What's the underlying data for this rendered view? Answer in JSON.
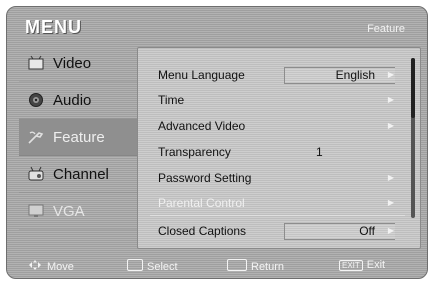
{
  "header": {
    "title": "MENU",
    "section": "Feature"
  },
  "sidebar": {
    "items": [
      {
        "label": "Video",
        "icon": "video-icon"
      },
      {
        "label": "Audio",
        "icon": "audio-icon"
      },
      {
        "label": "Feature",
        "icon": "feature-icon"
      },
      {
        "label": "Channel",
        "icon": "channel-icon"
      },
      {
        "label": "VGA",
        "icon": "vga-icon"
      }
    ]
  },
  "panel": {
    "rows": [
      {
        "label": "Menu Language",
        "value": "English"
      },
      {
        "label": "Time"
      },
      {
        "label": "Advanced Video"
      },
      {
        "label": "Transparency",
        "value": "1"
      },
      {
        "label": "Password Setting"
      },
      {
        "label": "Parental Control"
      },
      {
        "label": "Closed Captions",
        "value": "Off"
      }
    ]
  },
  "footer": {
    "move": "Move",
    "select": "Select",
    "return": "Return",
    "exit_icon_text": "EXIT",
    "exit": "Exit"
  }
}
